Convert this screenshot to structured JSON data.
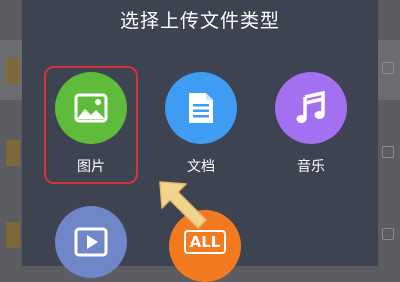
{
  "dialog": {
    "title": "选择上传文件类型",
    "options": [
      {
        "label": "图片",
        "icon": "image-icon",
        "color": "#5fbc3a",
        "highlighted": true
      },
      {
        "label": "文档",
        "icon": "document-icon",
        "color": "#3e9cf3"
      },
      {
        "label": "音乐",
        "icon": "music-icon",
        "color": "#a270f0"
      },
      {
        "label": "",
        "icon": "video-icon",
        "color": "#6f86c8"
      },
      {
        "label": "ALL",
        "icon": "all-files-icon",
        "color": "#f47a20"
      }
    ]
  },
  "annotation": {
    "arrow_color": "#f1d58e",
    "highlight_color": "#d8323c"
  }
}
